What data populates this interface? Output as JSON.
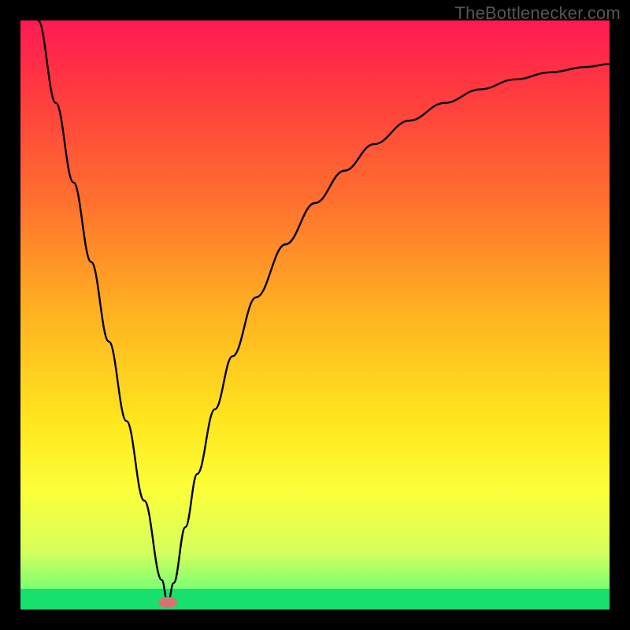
{
  "watermark_text": "TheBottlenecker.com",
  "chart_data": {
    "type": "line",
    "title": "",
    "xlabel": "",
    "ylabel": "",
    "xlim": [
      0,
      100
    ],
    "ylim": [
      0,
      100
    ],
    "gradient_stops": [
      {
        "offset": 0,
        "color": "#ff1a53"
      },
      {
        "offset": 0.12,
        "color": "#ff3a3f"
      },
      {
        "offset": 0.3,
        "color": "#ff6e2f"
      },
      {
        "offset": 0.5,
        "color": "#ffb321"
      },
      {
        "offset": 0.68,
        "color": "#ffe61e"
      },
      {
        "offset": 0.8,
        "color": "#fbff3a"
      },
      {
        "offset": 0.9,
        "color": "#d7ff5c"
      },
      {
        "offset": 0.965,
        "color": "#7cff74"
      },
      {
        "offset": 1.0,
        "color": "#11e46a"
      }
    ],
    "green_band": {
      "y_min": 0,
      "y_max": 3.5
    },
    "minimum_marker": {
      "x": 25,
      "y": 1.2,
      "color": "#d87272"
    },
    "series": [
      {
        "name": "bottleneck_curve",
        "x": [
          3,
          6,
          9,
          12,
          15,
          18,
          21,
          24,
          25,
          26,
          28,
          30,
          33,
          36,
          40,
          45,
          50,
          55,
          60,
          66,
          72,
          78,
          84,
          90,
          96,
          100
        ],
        "y": [
          100,
          86,
          72.5,
          59,
          45.5,
          32,
          18.5,
          5,
          1,
          4.5,
          14,
          23,
          34,
          43,
          53,
          62,
          69,
          74.5,
          79,
          83,
          86,
          88.3,
          90,
          91.2,
          92.1,
          92.6
        ]
      }
    ]
  }
}
